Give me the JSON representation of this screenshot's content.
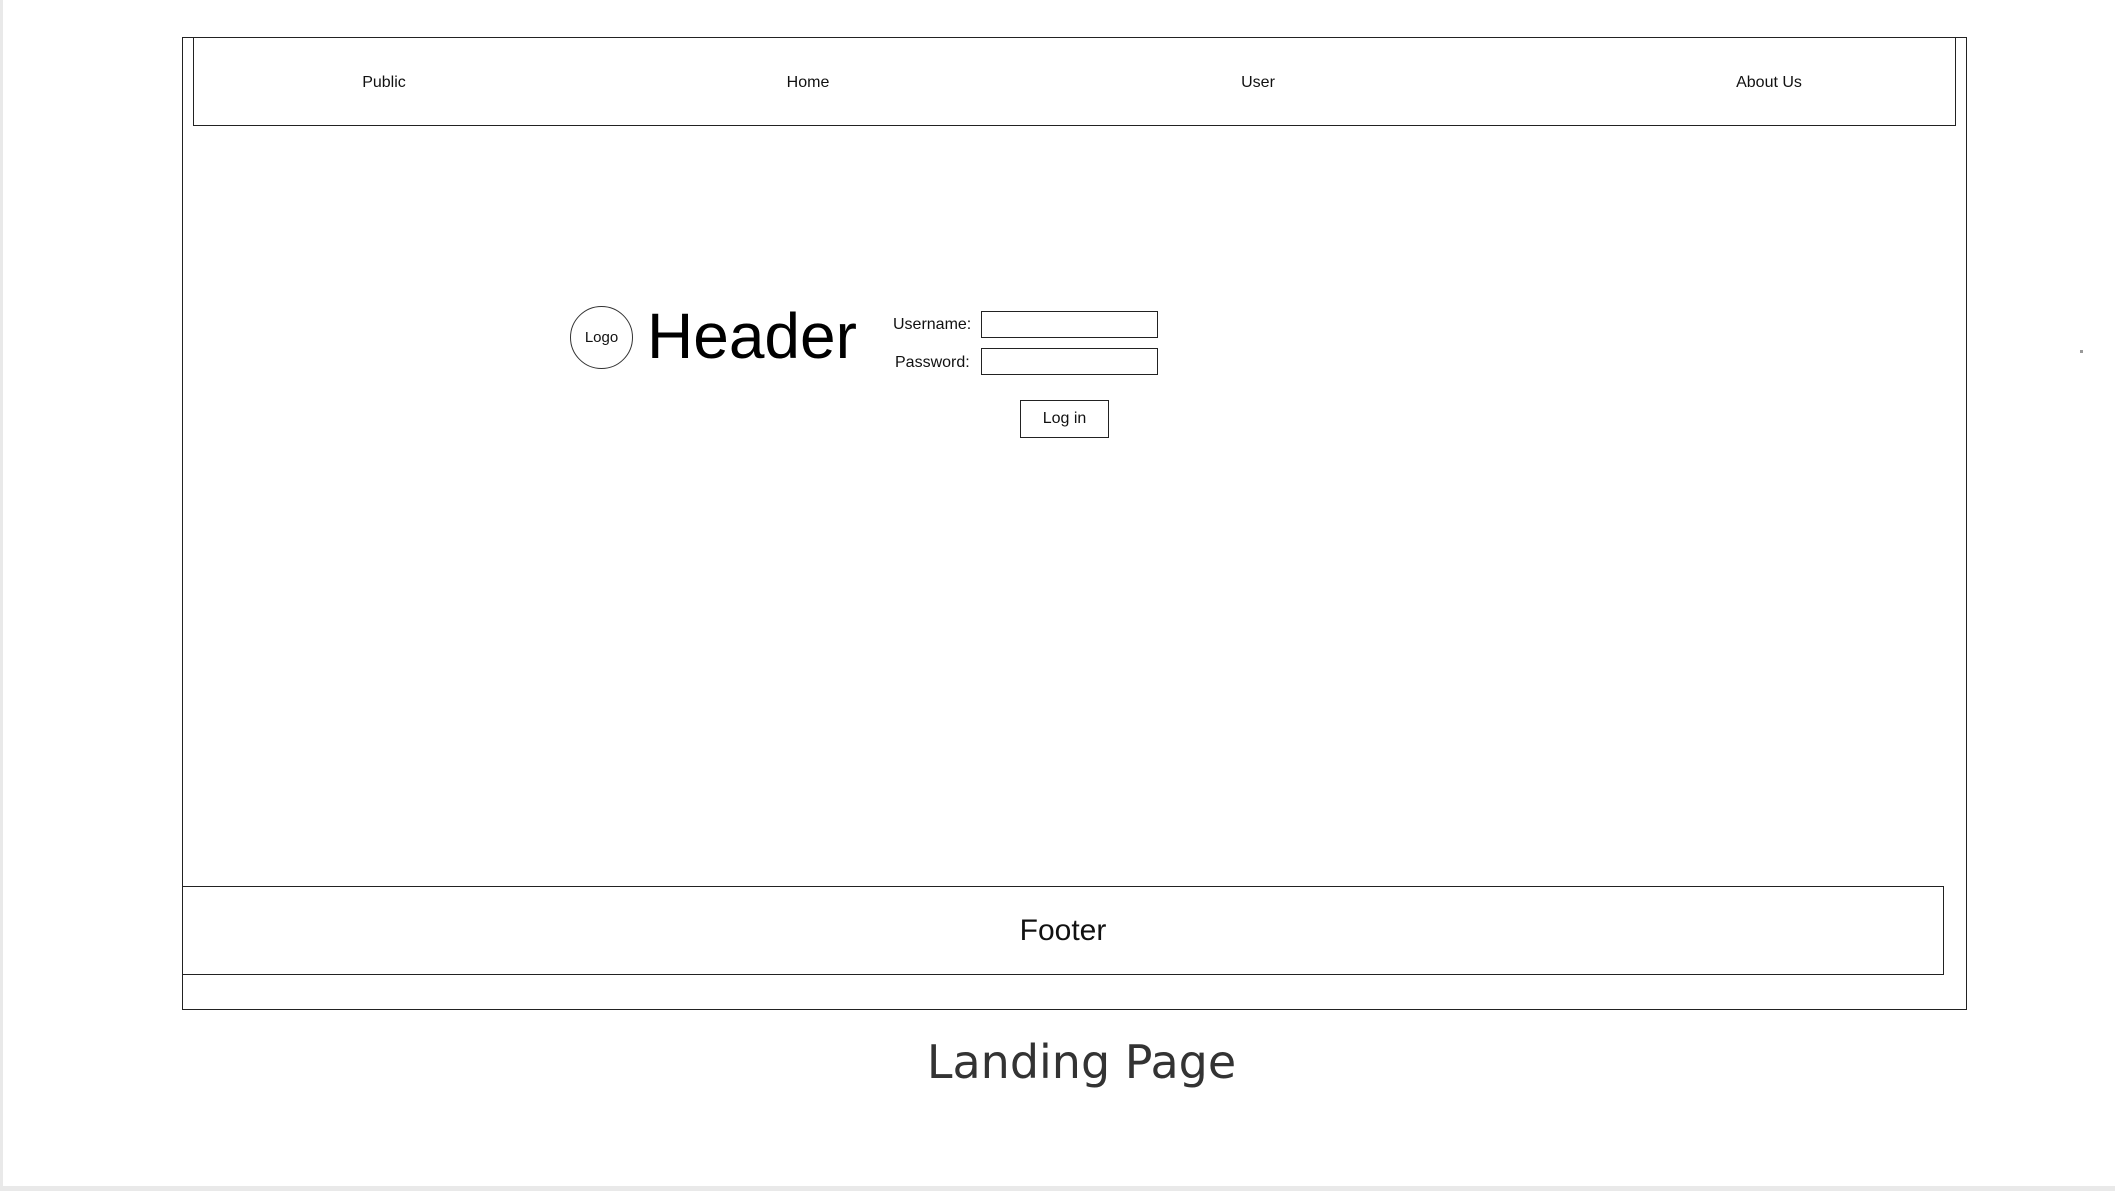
{
  "navbar": {
    "items": [
      {
        "label": "Public"
      },
      {
        "label": "Home"
      },
      {
        "label": "User"
      },
      {
        "label": "About Us"
      }
    ]
  },
  "hero": {
    "logo_text": "Logo",
    "header_text": "Header"
  },
  "login_form": {
    "username_label": "Username:",
    "username_value": "",
    "password_label": "Password:",
    "password_value": "",
    "login_button_label": "Log in"
  },
  "footer": {
    "text": "Footer"
  },
  "caption": "Landing Page"
}
